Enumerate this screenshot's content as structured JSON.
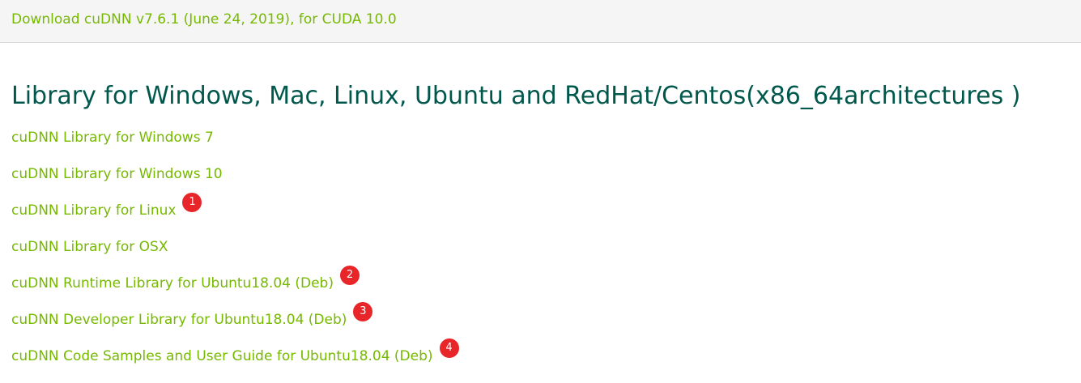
{
  "header": {
    "download_link": "Download cuDNN v7.6.1 (June 24, 2019), for CUDA 10.0"
  },
  "section": {
    "title": "Library for Windows, Mac, Linux, Ubuntu and RedHat/Centos(x86_64architectures )"
  },
  "links": [
    {
      "label": "cuDNN Library for Windows 7",
      "badge": ""
    },
    {
      "label": "cuDNN Library for Windows 10",
      "badge": ""
    },
    {
      "label": "cuDNN Library for Linux",
      "badge": "1"
    },
    {
      "label": "cuDNN Library for OSX",
      "badge": ""
    },
    {
      "label": "cuDNN Runtime Library for Ubuntu18.04 (Deb)",
      "badge": "2"
    },
    {
      "label": "cuDNN Developer Library for Ubuntu18.04 (Deb)",
      "badge": "3"
    },
    {
      "label": "cuDNN Code Samples and User Guide for Ubuntu18.04 (Deb)",
      "badge": "4"
    }
  ],
  "colors": {
    "link": "#76b900",
    "title": "#00574b",
    "badge": "#e8262a",
    "header_bg": "#f5f5f5"
  }
}
